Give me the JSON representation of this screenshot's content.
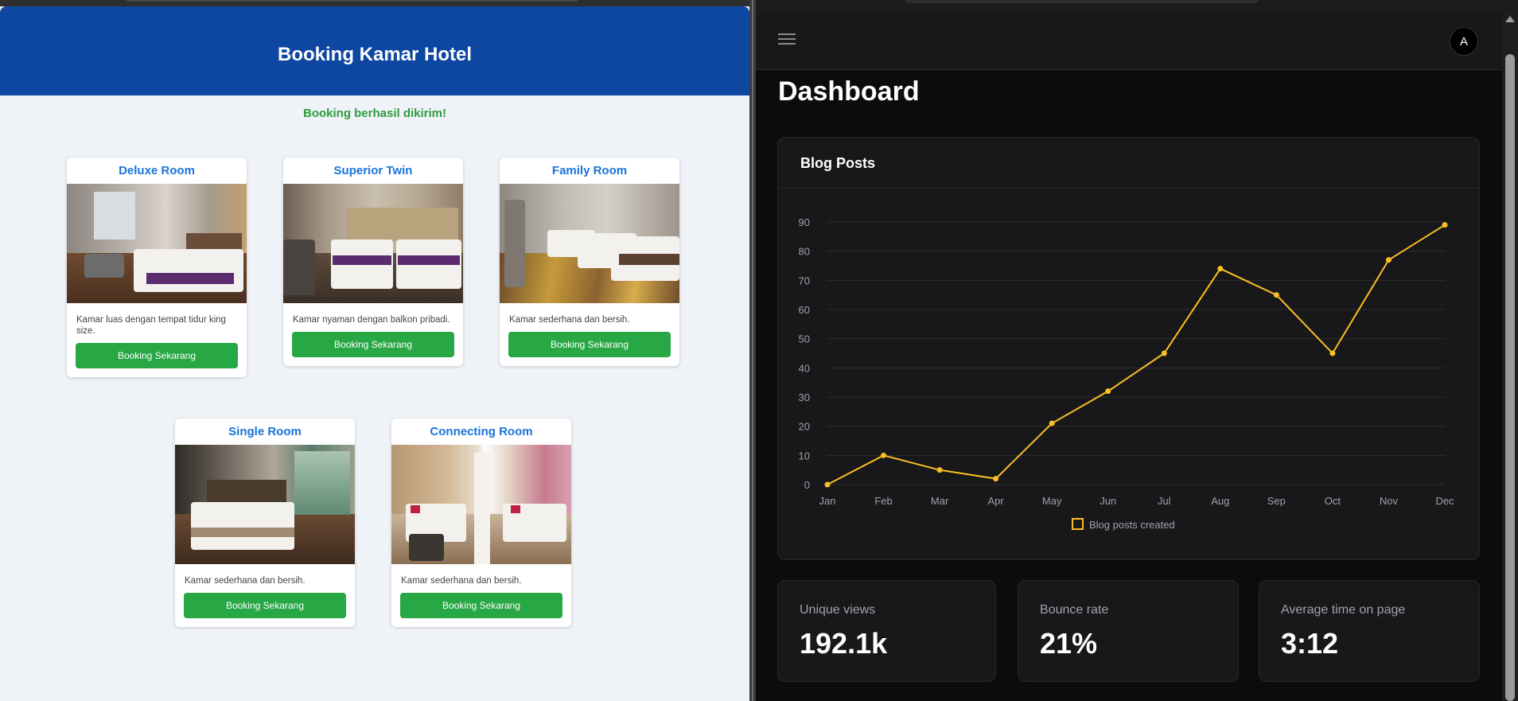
{
  "hotel": {
    "title": "Booking Kamar Hotel",
    "success_message": "Booking berhasil dikirim!",
    "rooms": [
      {
        "name": "Deluxe Room",
        "description": "Kamar luas dengan tempat tidur king size.",
        "button": "Booking Sekarang"
      },
      {
        "name": "Superior Twin",
        "description": "Kamar nyaman dengan balkon pribadi.",
        "button": "Booking Sekarang"
      },
      {
        "name": "Family Room",
        "description": "Kamar sederhana dan bersih.",
        "button": "Booking Sekarang"
      },
      {
        "name": "Single Room",
        "description": "Kamar sederhana dan bersih.",
        "button": "Booking Sekarang"
      },
      {
        "name": "Connecting Room",
        "description": "Kamar sederhana dan bersih.",
        "button": "Booking Sekarang"
      }
    ]
  },
  "dashboard": {
    "avatar_initial": "A",
    "title": "Dashboard",
    "chart_card_title": "Blog Posts",
    "stats": [
      {
        "label": "Unique views",
        "value": "192.1k"
      },
      {
        "label": "Bounce rate",
        "value": "21%"
      },
      {
        "label": "Average time on page",
        "value": "3:12"
      }
    ]
  },
  "colors": {
    "hotel_header": "#0d47a1",
    "room_title": "#1a73d9",
    "success": "#2e9b3f",
    "button": "#28a745",
    "chart_line": "#fbbf24"
  },
  "chart_data": {
    "type": "line",
    "title": "Blog Posts",
    "categories": [
      "Jan",
      "Feb",
      "Mar",
      "Apr",
      "May",
      "Jun",
      "Jul",
      "Aug",
      "Sep",
      "Oct",
      "Nov",
      "Dec"
    ],
    "series": [
      {
        "name": "Blog posts created",
        "values": [
          0,
          10,
          5,
          2,
          21,
          32,
          45,
          74,
          65,
          45,
          77,
          89
        ],
        "color": "#fbbf24"
      }
    ],
    "yticks": [
      0,
      10,
      20,
      30,
      40,
      50,
      60,
      70,
      80,
      90
    ],
    "ylim": [
      0,
      90
    ],
    "grid": true,
    "legend_position": "bottom"
  }
}
